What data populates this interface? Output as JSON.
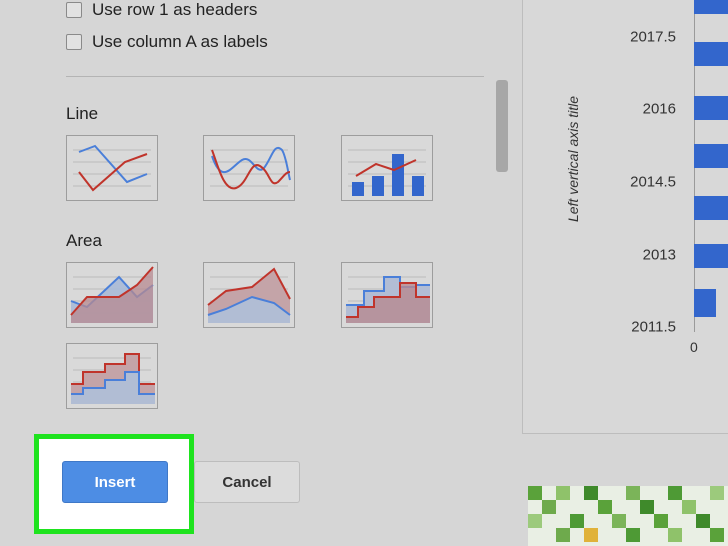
{
  "options": {
    "row1_headers": "Use row 1 as headers",
    "colA_labels": "Use column A as labels"
  },
  "sections": {
    "line": "Line",
    "area": "Area"
  },
  "chart_types": {
    "line": [
      "line-chart",
      "smooth-line-chart",
      "combo-chart"
    ],
    "area": [
      "area-chart",
      "stacked-area-chart",
      "stepped-area-chart",
      "stacked-stepped-area-chart"
    ]
  },
  "buttons": {
    "insert": "Insert",
    "cancel": "Cancel"
  },
  "preview": {
    "y_axis_title": "Left vertical axis title",
    "y_ticks": [
      "2017.5",
      "2016",
      "2014.5",
      "2013",
      "2011.5"
    ],
    "x_tick": "0"
  },
  "colors": {
    "blue_series": "#4a7fd9",
    "red_series": "#c0342b",
    "bar": "#3366cc",
    "insert_button": "#4d8de4",
    "highlight": "#1ee31e"
  }
}
